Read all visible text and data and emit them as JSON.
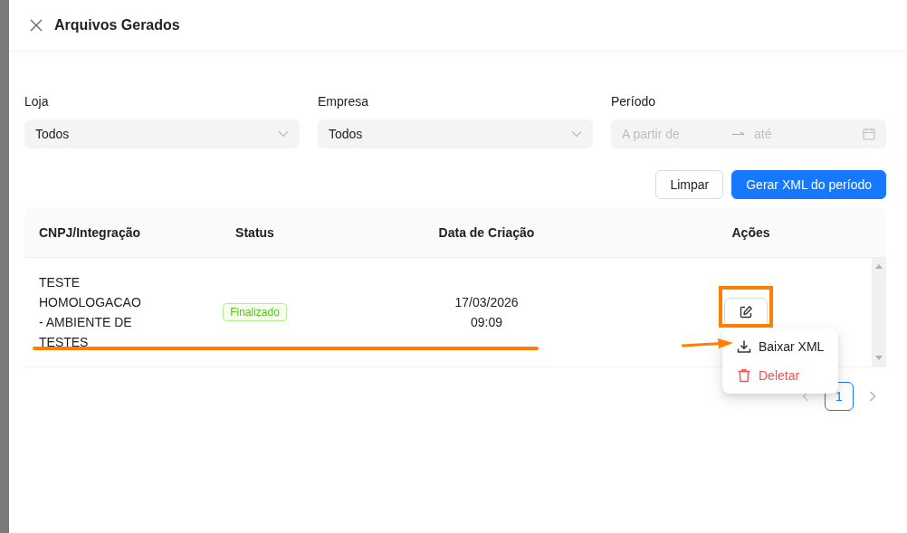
{
  "drawer": {
    "title": "Arquivos Gerados"
  },
  "filters": [
    {
      "kind": "select",
      "label": "Loja",
      "value": "Todos"
    },
    {
      "kind": "select",
      "label": "Empresa",
      "value": "Todos"
    },
    {
      "kind": "range",
      "label": "Período",
      "placeholder": "A partir de",
      "placeholder_end": "até"
    }
  ],
  "buttons": [
    {
      "kind": "default",
      "label": "Limpar"
    },
    {
      "kind": "primary",
      "label": "Gerar XML do período"
    }
  ],
  "table": {
    "columns": [
      "CNPJ/Integração",
      "Status",
      "Data de Criação",
      "Ações"
    ],
    "rows": [
      {
        "name": "TESTE HOMOLOGACAO - AMBIENTE DE TESTES",
        "status": "Finalizado",
        "date": "17/03/2026",
        "time": "09:09"
      }
    ]
  },
  "action_menu": [
    {
      "kind": "download",
      "label": "Baixar XML"
    },
    {
      "kind": "danger",
      "label": "Deletar"
    }
  ],
  "pagination": [
    {
      "label": "1",
      "selected": true
    }
  ]
}
